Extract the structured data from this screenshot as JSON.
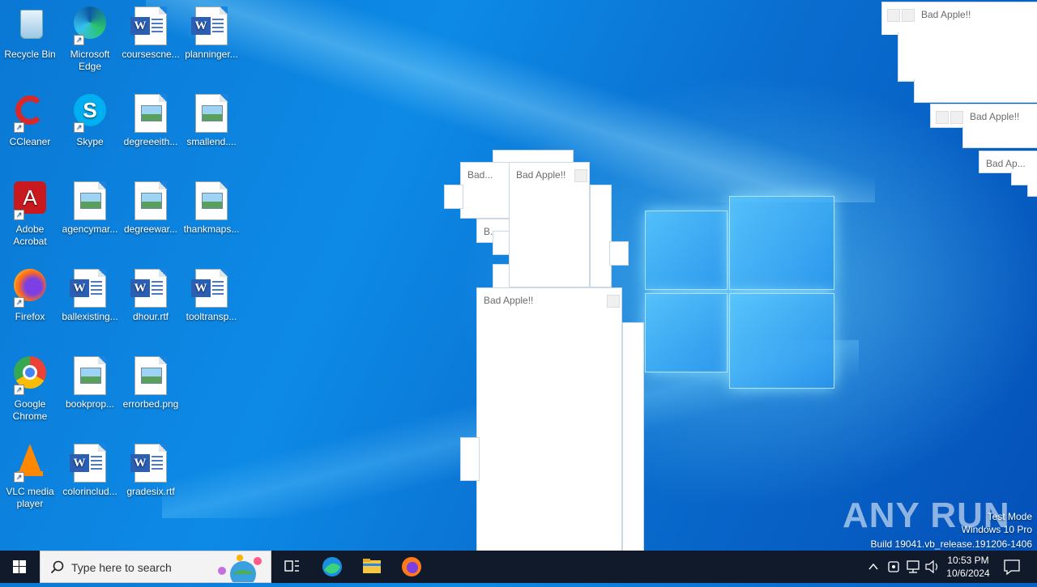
{
  "desktop_icons": [
    {
      "label": "Recycle Bin"
    },
    {
      "label": "Microsoft Edge"
    },
    {
      "label": "coursescne..."
    },
    {
      "label": "planninger..."
    },
    {
      "label": "CCleaner"
    },
    {
      "label": "Skype"
    },
    {
      "label": "degreeeith..."
    },
    {
      "label": "smallend...."
    },
    {
      "label": "Adobe Acrobat"
    },
    {
      "label": "agencymar..."
    },
    {
      "label": "degreewar..."
    },
    {
      "label": "thankmaps..."
    },
    {
      "label": "Firefox"
    },
    {
      "label": "ballexisting..."
    },
    {
      "label": "dhour.rtf"
    },
    {
      "label": "tooltransp..."
    },
    {
      "label": "Google Chrome"
    },
    {
      "label": "bookprop..."
    },
    {
      "label": "errorbed.png"
    },
    {
      "label": "VLC media player"
    },
    {
      "label": "colorinclud..."
    },
    {
      "label": "gradesix.rtf"
    }
  ],
  "windows": [
    {
      "title": "Bad Apple!!"
    },
    {
      "title": "Bad Apple!!"
    },
    {
      "title": "Bad Ap..."
    },
    {
      "title": "Bad Apple!!"
    },
    {
      "title": "Bad..."
    },
    {
      "title": "Bad Apple!!"
    },
    {
      "title": "Bad Apple!!"
    },
    {
      "title": "B..."
    }
  ],
  "taskbar": {
    "search_placeholder": "Type here to search",
    "time": "10:53 PM",
    "date": "10/6/2024"
  },
  "watermark": {
    "line1": "Test Mode",
    "line2": "Windows 10 Pro",
    "line3": "Build 19041.vb_release.191206-1406",
    "brand": "ANY RUN"
  },
  "colors": {
    "accent": "#0a78d4",
    "taskbar": "#101a2a"
  },
  "icons": [
    "windows-start-icon",
    "search-icon",
    "task-view-icon",
    "edge-icon",
    "file-explorer-icon",
    "firefox-icon",
    "notification-icon"
  ]
}
